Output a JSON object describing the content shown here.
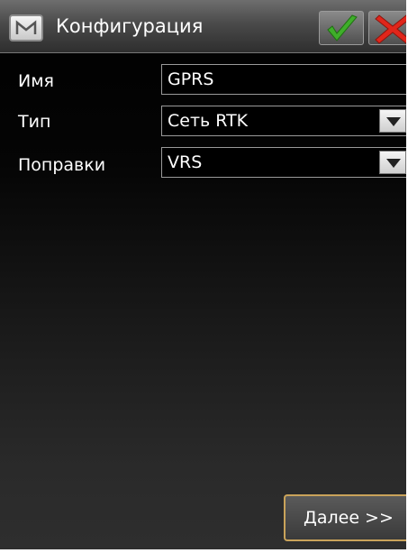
{
  "window": {
    "title": "Конфигурация",
    "app_icon": "m-logo-icon",
    "ok_icon": "check-icon",
    "cancel_icon": "close-x-icon"
  },
  "form": {
    "name_label": "Имя",
    "name_value": "GPRS",
    "type_label": "Тип",
    "type_value": "Сеть RTK",
    "corrections_label": "Поправки",
    "corrections_value": "VRS"
  },
  "footer": {
    "next_label": "Далее >>"
  },
  "colors": {
    "ok_green": "#3fae2a",
    "cancel_red": "#e0261b",
    "next_border": "#c9a35a"
  }
}
